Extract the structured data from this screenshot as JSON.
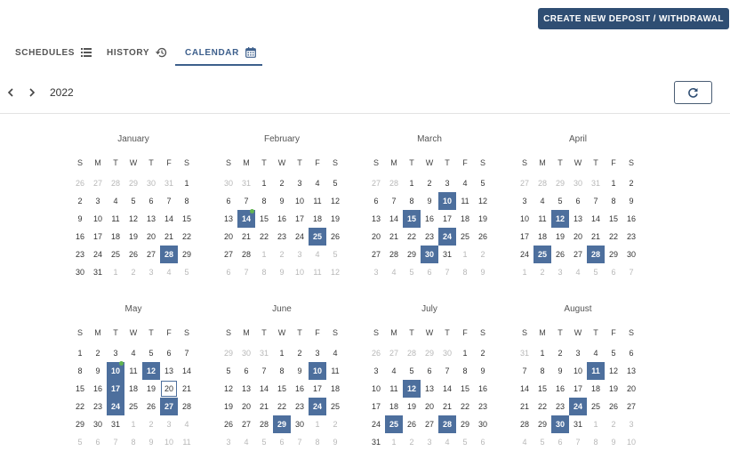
{
  "header": {
    "create_button": "CREATE NEW DEPOSIT / WITHDRAWAL"
  },
  "tabs": [
    {
      "label": "SCHEDULES",
      "icon": "list-icon"
    },
    {
      "label": "HISTORY",
      "icon": "history-icon"
    },
    {
      "label": "CALENDAR",
      "icon": "calendar-icon"
    }
  ],
  "active_tab": "CALENDAR",
  "year": "2022",
  "weekday_labels": [
    "S",
    "M",
    "T",
    "W",
    "T",
    "F",
    "S"
  ],
  "colors": {
    "accent": "#2f4e73",
    "highlight": "#4d6f9d",
    "event_dot": "#62b450"
  },
  "months": [
    {
      "name": "January",
      "weeks": [
        [
          "26",
          "27",
          "28",
          "29",
          "30",
          "31",
          "1"
        ],
        [
          "2",
          "3",
          "4",
          "5",
          "6",
          "7",
          "8"
        ],
        [
          "9",
          "10",
          "11",
          "12",
          "13",
          "14",
          "15"
        ],
        [
          "16",
          "17",
          "18",
          "19",
          "20",
          "21",
          "22"
        ],
        [
          "23",
          "24",
          "25",
          "26",
          "27",
          "28",
          "29"
        ],
        [
          "30",
          "31",
          "1",
          "2",
          "3",
          "4",
          "5"
        ]
      ],
      "highlighted": [
        "28"
      ],
      "event_dots": [],
      "today": null
    },
    {
      "name": "February",
      "weeks": [
        [
          "30",
          "31",
          "1",
          "2",
          "3",
          "4",
          "5"
        ],
        [
          "6",
          "7",
          "8",
          "9",
          "10",
          "11",
          "12"
        ],
        [
          "13",
          "14",
          "15",
          "16",
          "17",
          "18",
          "19"
        ],
        [
          "20",
          "21",
          "22",
          "23",
          "24",
          "25",
          "26"
        ],
        [
          "27",
          "28",
          "1",
          "2",
          "3",
          "4",
          "5"
        ],
        [
          "6",
          "7",
          "8",
          "9",
          "10",
          "11",
          "12"
        ]
      ],
      "highlighted": [
        "14",
        "25"
      ],
      "event_dots": [
        "14"
      ],
      "today": null
    },
    {
      "name": "March",
      "weeks": [
        [
          "27",
          "28",
          "1",
          "2",
          "3",
          "4",
          "5"
        ],
        [
          "6",
          "7",
          "8",
          "9",
          "10",
          "11",
          "12"
        ],
        [
          "13",
          "14",
          "15",
          "16",
          "17",
          "18",
          "19"
        ],
        [
          "20",
          "21",
          "22",
          "23",
          "24",
          "25",
          "26"
        ],
        [
          "27",
          "28",
          "29",
          "30",
          "31",
          "1",
          "2"
        ],
        [
          "3",
          "4",
          "5",
          "6",
          "7",
          "8",
          "9"
        ]
      ],
      "highlighted": [
        "10",
        "15",
        "24",
        "30"
      ],
      "event_dots": [],
      "today": null
    },
    {
      "name": "April",
      "weeks": [
        [
          "27",
          "28",
          "29",
          "30",
          "31",
          "1",
          "2"
        ],
        [
          "3",
          "4",
          "5",
          "6",
          "7",
          "8",
          "9"
        ],
        [
          "10",
          "11",
          "12",
          "13",
          "14",
          "15",
          "16"
        ],
        [
          "17",
          "18",
          "19",
          "20",
          "21",
          "22",
          "23"
        ],
        [
          "24",
          "25",
          "26",
          "27",
          "28",
          "29",
          "30"
        ],
        [
          "1",
          "2",
          "3",
          "4",
          "5",
          "6",
          "7"
        ]
      ],
      "highlighted": [
        "12",
        "25",
        "28"
      ],
      "event_dots": [],
      "today": null
    },
    {
      "name": "May",
      "weeks": [
        [
          "1",
          "2",
          "3",
          "4",
          "5",
          "6",
          "7"
        ],
        [
          "8",
          "9",
          "10",
          "11",
          "12",
          "13",
          "14"
        ],
        [
          "15",
          "16",
          "17",
          "18",
          "19",
          "20",
          "21"
        ],
        [
          "22",
          "23",
          "24",
          "25",
          "26",
          "27",
          "28"
        ],
        [
          "29",
          "30",
          "31",
          "1",
          "2",
          "3",
          "4"
        ],
        [
          "5",
          "6",
          "7",
          "8",
          "9",
          "10",
          "11"
        ]
      ],
      "highlighted": [
        "10",
        "12",
        "17",
        "24",
        "27"
      ],
      "event_dots": [
        "10"
      ],
      "today": "20"
    },
    {
      "name": "June",
      "weeks": [
        [
          "29",
          "30",
          "31",
          "1",
          "2",
          "3",
          "4"
        ],
        [
          "5",
          "6",
          "7",
          "8",
          "9",
          "10",
          "11"
        ],
        [
          "12",
          "13",
          "14",
          "15",
          "16",
          "17",
          "18"
        ],
        [
          "19",
          "20",
          "21",
          "22",
          "23",
          "24",
          "25"
        ],
        [
          "26",
          "27",
          "28",
          "29",
          "30",
          "1",
          "2"
        ],
        [
          "3",
          "4",
          "5",
          "6",
          "7",
          "8",
          "9"
        ]
      ],
      "highlighted": [
        "10",
        "24",
        "29"
      ],
      "event_dots": [],
      "today": null
    },
    {
      "name": "July",
      "weeks": [
        [
          "26",
          "27",
          "28",
          "29",
          "30",
          "1",
          "2"
        ],
        [
          "3",
          "4",
          "5",
          "6",
          "7",
          "8",
          "9"
        ],
        [
          "10",
          "11",
          "12",
          "13",
          "14",
          "15",
          "16"
        ],
        [
          "17",
          "18",
          "19",
          "20",
          "21",
          "22",
          "23"
        ],
        [
          "24",
          "25",
          "26",
          "27",
          "28",
          "29",
          "30"
        ],
        [
          "31",
          "1",
          "2",
          "3",
          "4",
          "5",
          "6"
        ]
      ],
      "highlighted": [
        "12",
        "25",
        "28"
      ],
      "event_dots": [],
      "today": null
    },
    {
      "name": "August",
      "weeks": [
        [
          "31",
          "1",
          "2",
          "3",
          "4",
          "5",
          "6"
        ],
        [
          "7",
          "8",
          "9",
          "10",
          "11",
          "12",
          "13"
        ],
        [
          "14",
          "15",
          "16",
          "17",
          "18",
          "19",
          "20"
        ],
        [
          "21",
          "22",
          "23",
          "24",
          "25",
          "26",
          "27"
        ],
        [
          "28",
          "29",
          "30",
          "31",
          "1",
          "2",
          "3"
        ],
        [
          "4",
          "5",
          "6",
          "7",
          "8",
          "9",
          "10"
        ]
      ],
      "highlighted": [
        "11",
        "24",
        "30"
      ],
      "event_dots": [],
      "today": null
    }
  ]
}
